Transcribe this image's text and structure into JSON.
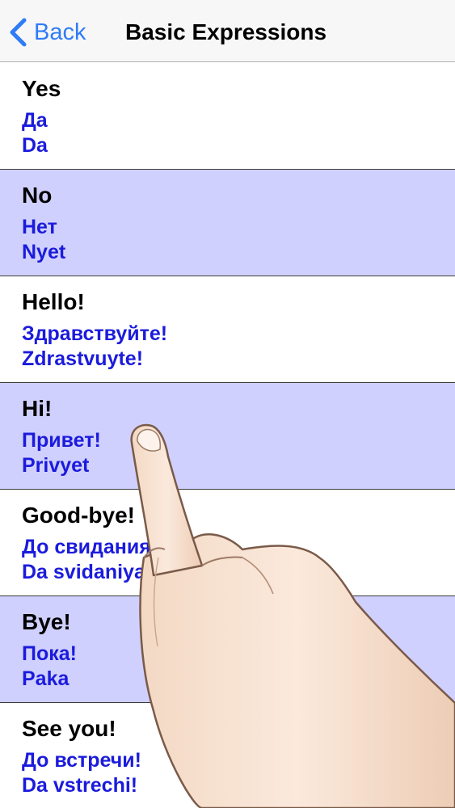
{
  "navbar": {
    "back_label": "Back",
    "title": "Basic Expressions",
    "back_icon": "chevron-left-icon",
    "accent_color": "#2f7cf6"
  },
  "colors": {
    "row_alt_background": "#d0d0ff",
    "translation_text": "#1b1bdc"
  },
  "expressions": [
    {
      "english": "Yes",
      "russian": "Да",
      "transliteration": "Da"
    },
    {
      "english": "No",
      "russian": "Нет",
      "transliteration": "Nyet"
    },
    {
      "english": "Hello!",
      "russian": "Здравствуйте!",
      "transliteration": "Zdrastvuyte!"
    },
    {
      "english": "Hi!",
      "russian": "Привет!",
      "transliteration": "Privyet"
    },
    {
      "english": "Good-bye!",
      "russian": "До свидания!",
      "transliteration": "Da svidaniya!"
    },
    {
      "english": "Bye!",
      "russian": "Пока!",
      "transliteration": "Paka"
    },
    {
      "english": "See you!",
      "russian": "До встречи!",
      "transliteration": "Da vstrechi!"
    }
  ],
  "overlay": {
    "icon": "pointing-hand-icon"
  }
}
